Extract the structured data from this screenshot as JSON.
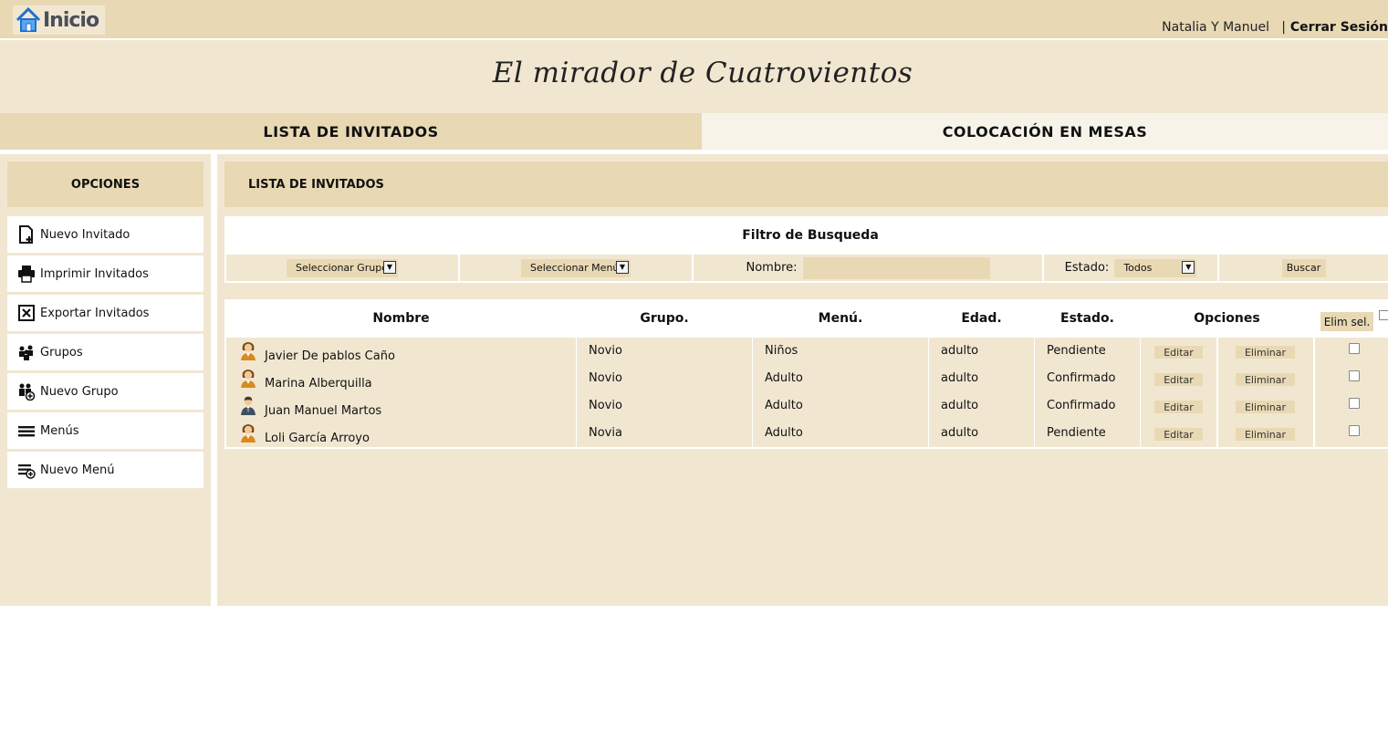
{
  "header": {
    "home_label": "Inicio",
    "user_name": "Natalia Y Manuel",
    "separator": "|",
    "logout_label": "Cerrar Sesión"
  },
  "banner": {
    "title": "El mirador de Cuatrovientos"
  },
  "tabs": [
    {
      "label": "LISTA DE INVITADOS",
      "active": true
    },
    {
      "label": "COLOCACIÓN EN MESAS",
      "active": false
    }
  ],
  "sidebar": {
    "title": "OPCIONES",
    "items": [
      {
        "label": "Nuevo Invitado",
        "icon": "new-document-icon"
      },
      {
        "label": "Imprimir Invitados",
        "icon": "printer-icon"
      },
      {
        "label": "Exportar Invitados",
        "icon": "excel-export-icon"
      },
      {
        "label": "Grupos",
        "icon": "group-icon"
      },
      {
        "label": "Nuevo Grupo",
        "icon": "add-group-icon"
      },
      {
        "label": "Menús",
        "icon": "menu-lines-icon"
      },
      {
        "label": "Nuevo Menú",
        "icon": "add-menu-icon"
      }
    ]
  },
  "main": {
    "title": "LISTA DE INVITADOS",
    "filter": {
      "title": "Filtro de Busqueda",
      "group_select": "Seleccionar Grupo",
      "menu_select": "Seleccionar Menú",
      "name_label": "Nombre:",
      "name_value": "",
      "status_label": "Estado:",
      "status_select": "Todos",
      "search_button": "Buscar"
    },
    "table": {
      "headers": [
        "Nombre",
        "Grupo.",
        "Menú.",
        "Edad.",
        "Estado.",
        "Opciones"
      ],
      "delete_selected": "Elim sel.",
      "edit_label": "Editar",
      "delete_label": "Eliminar",
      "rows": [
        {
          "name": "Javier De pablos Caño",
          "group": "Novio",
          "menu": "Niños",
          "age": "adulto",
          "status": "Pendiente",
          "avatar": "female-user-icon"
        },
        {
          "name": "Marina Alberquilla",
          "group": "Novio",
          "menu": "Adulto",
          "age": "adulto",
          "status": "Confirmado",
          "avatar": "female-user-icon"
        },
        {
          "name": "Juan Manuel Martos",
          "group": "Novio",
          "menu": "Adulto",
          "age": "adulto",
          "status": "Confirmado",
          "avatar": "male-user-icon"
        },
        {
          "name": "Loli García Arroyo",
          "group": "Novia",
          "menu": "Adulto",
          "age": "adulto",
          "status": "Pendiente",
          "avatar": "female-user-icon"
        }
      ]
    }
  },
  "colors": {
    "tan": "#e8d9b4",
    "cream": "#f1e7d1",
    "light": "#f8f3e9"
  }
}
